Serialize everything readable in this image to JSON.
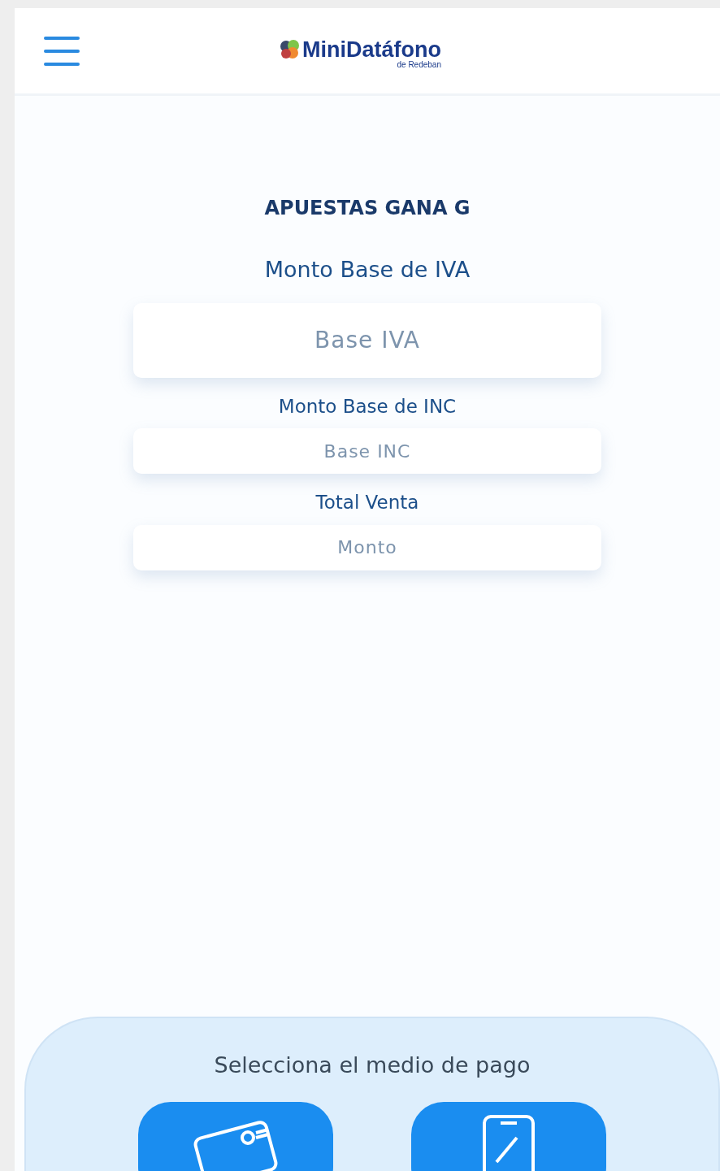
{
  "header": {
    "logo_title": "MiniDatáfono",
    "logo_subtitle": "de Redeban"
  },
  "merchant": "APUESTAS GANA G",
  "fields": [
    {
      "label": "Monto Base de IVA",
      "placeholder": "Base IVA",
      "kind": "large"
    },
    {
      "label": "Monto Base de INC",
      "placeholder": "Base INC",
      "kind": "small"
    },
    {
      "label": "Total Venta",
      "placeholder": "Monto",
      "kind": "small"
    }
  ],
  "payment": {
    "title": "Selecciona el medio de pago",
    "methods": [
      {
        "kind": "card"
      },
      {
        "kind": "phone"
      }
    ]
  }
}
